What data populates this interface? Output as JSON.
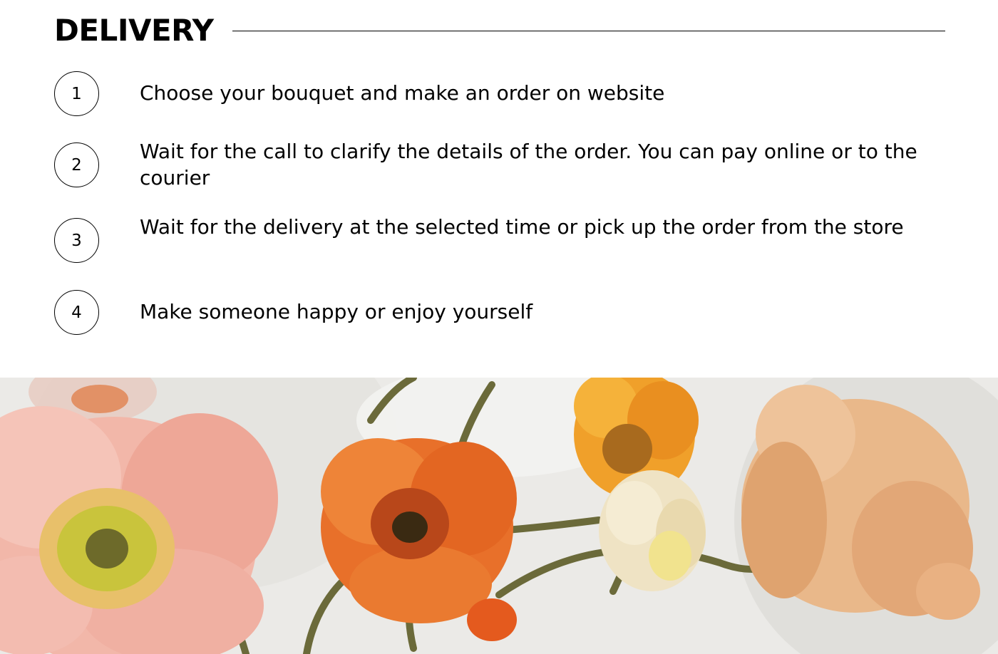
{
  "delivery": {
    "title": "DELIVERY",
    "steps": [
      {
        "number": "1",
        "text": "Choose your bouquet and make an order on website"
      },
      {
        "number": "2",
        "text": "Wait for the call to clarify the details of the order. You can pay online or to the courier"
      },
      {
        "number": "3",
        "text": "Wait for the delivery at the selected time or pick up the order from the store"
      },
      {
        "number": "4",
        "text": "Make someone happy or enjoy yourself"
      }
    ]
  },
  "hero": {
    "image_description": "poppy-flowers-photo",
    "colors": {
      "pink_petal": "#f2b7a9",
      "orange_petal": "#e8702a",
      "yellow_petal": "#f0a02a",
      "peach_petal": "#e9b88a",
      "cream_bud": "#efe3c4",
      "stem": "#6b6a3a",
      "background": "#ecebe8"
    }
  }
}
